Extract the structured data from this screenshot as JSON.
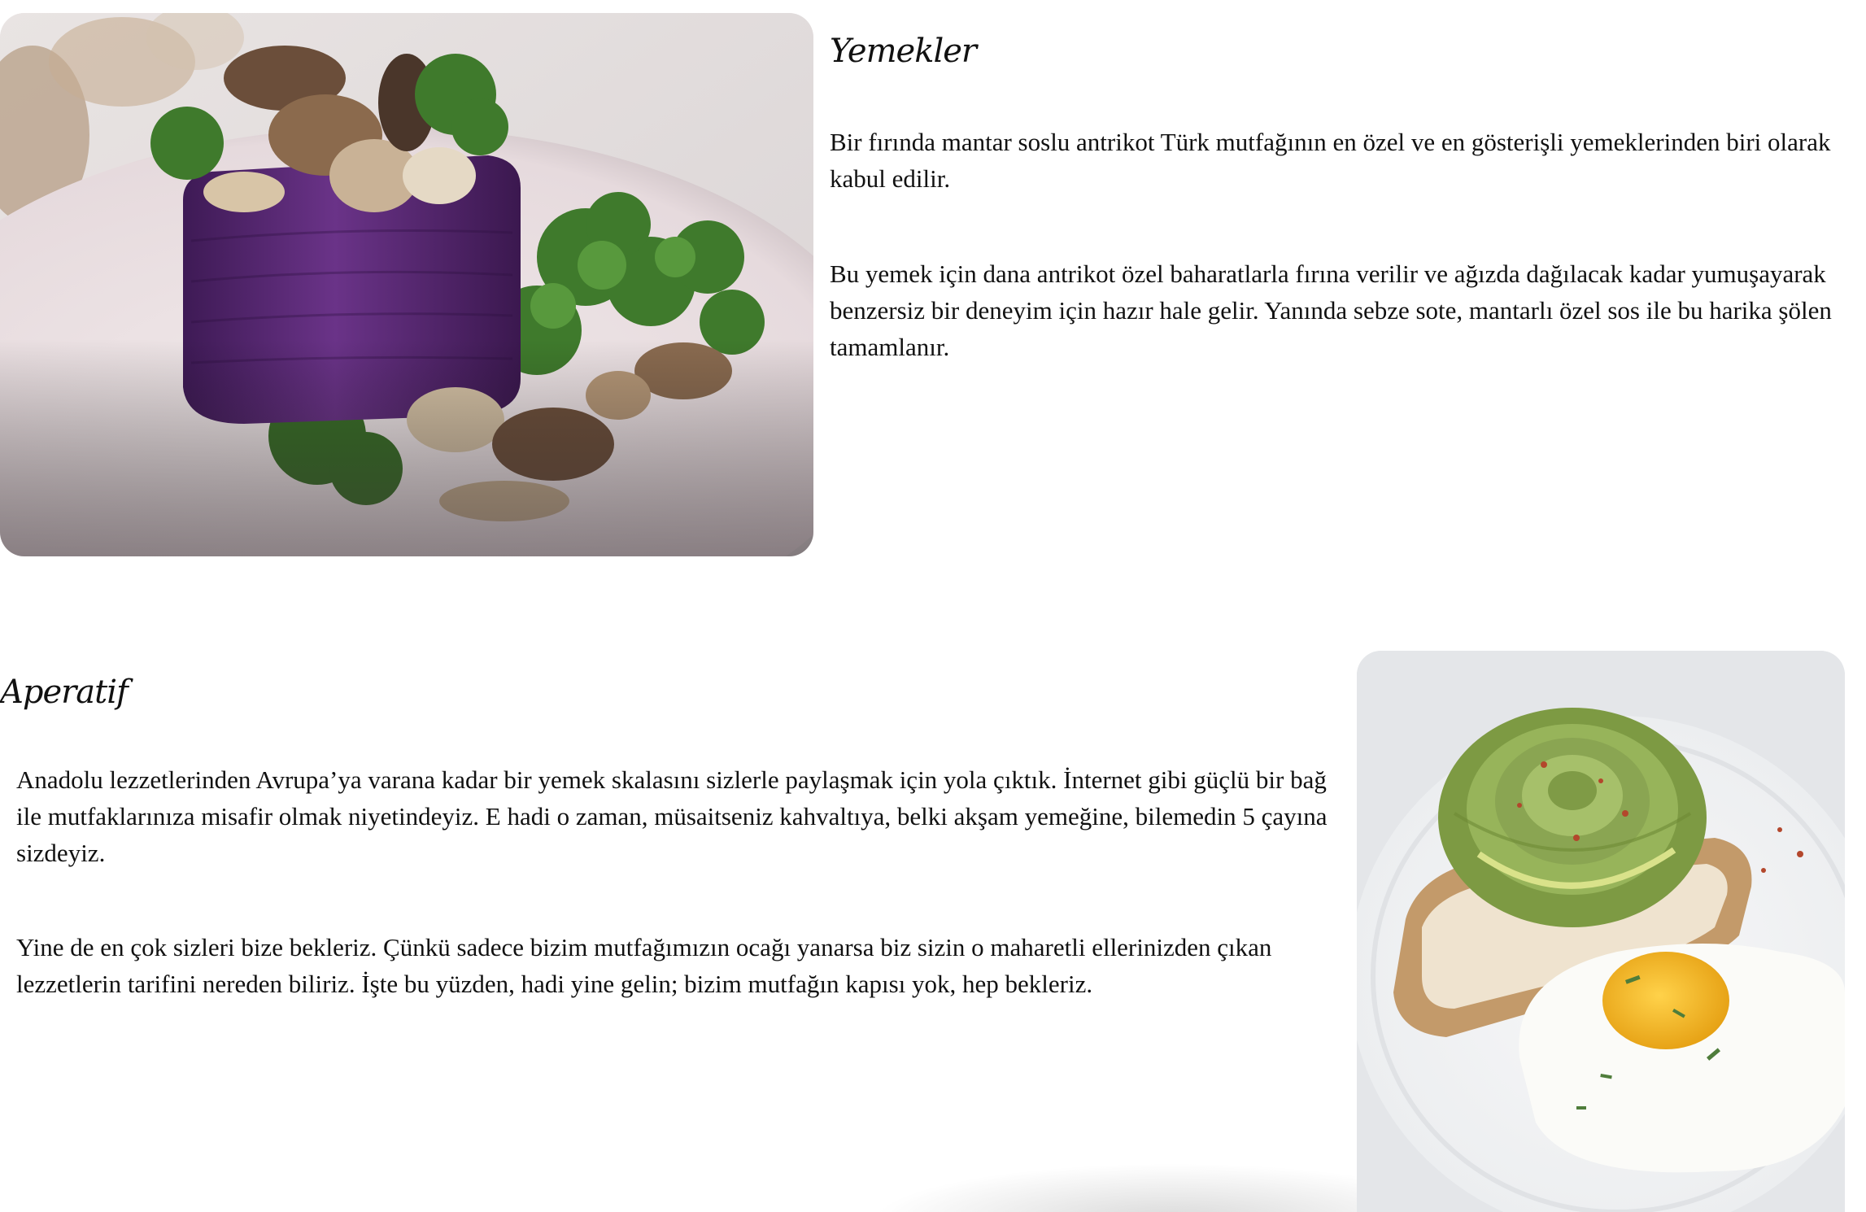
{
  "sections": [
    {
      "heading": "Yemekler",
      "image_alt": "Purple mashed potato tower with sautéed mushrooms and kale",
      "paragraphs": [
        "Bir fırında mantar soslu antrikot Türk mutfağının en özel ve en gösterişli yemeklerinden biri olarak kabul edilir.",
        "Bu yemek için dana antrikot özel baharatlarla fırına verilir ve ağızda dağılacak kadar yumuşayarak benzersiz bir deneyim için hazır hale gelir. Yanında sebze sote, mantarlı özel sos ile bu harika şölen tamamlanır."
      ]
    },
    {
      "heading": "Aperatif",
      "image_alt": "Avocado rose toast with fried egg",
      "paragraphs": [
        "Anadolu lezzetlerinden Avrupa’ya varana kadar bir yemek skalasını sizlerle paylaşmak için yola çıktık. İnternet gibi güçlü bir bağ ile mutfaklarınıza misafir olmak niyetindeyiz. E hadi o zaman, müsaitseniz kahvaltıya, belki akşam yemeğine, bilemedin 5 çayına sizdeyiz.",
        "Yine de en çok sizleri bize bekleriz. Çünkü sadece bizim mutfağımızın ocağı yanarsa biz sizin o maharetli ellerinizden çıkan lezzetlerin tarifini nereden biliriz. İşte bu yüzden, hadi yine gelin; bizim mutfağın kapısı yok, hep bekleriz."
      ]
    }
  ],
  "colors": {
    "text": "#111111",
    "background": "#ffffff",
    "purple_mash": "#5a2a74",
    "kale_green": "#3f7a2c",
    "avocado_green": "#8aa552",
    "egg_yolk": "#f2b51e"
  }
}
